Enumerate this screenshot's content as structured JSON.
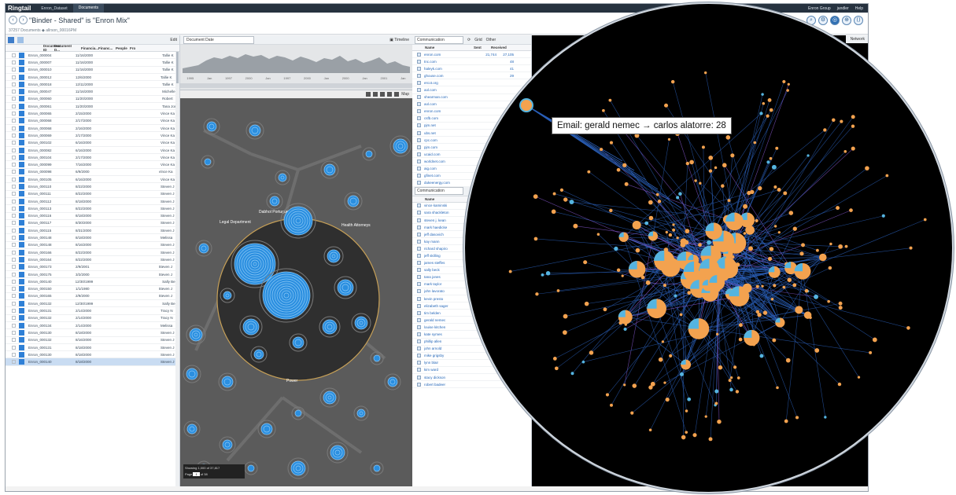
{
  "topbar": {
    "logo": "Ringtail",
    "case": "Enron_Dataset",
    "menu": "Documents",
    "right_items": [
      "Enron Group",
      "jandler",
      "Help"
    ]
  },
  "binder": {
    "title": "\"Binder - Shared\" is \"Enron Mix\"",
    "subtitle": "37257 Documents  ◆ allrson_00016PM"
  },
  "list": {
    "edit_label": "Edit",
    "headers": [
      "Document ID",
      "Document D...",
      "Financia...",
      "Financ...",
      "People",
      "Fro"
    ],
    "rows": [
      {
        "id": "Enron_000004",
        "date": "11/16/2000",
        "who": "Tallie K"
      },
      {
        "id": "Enron_000007",
        "date": "11/16/2000",
        "who": "Tallie K"
      },
      {
        "id": "Enron_000010",
        "date": "11/16/2000",
        "who": "Tallie K"
      },
      {
        "id": "Enron_000012",
        "date": "12/6/2000",
        "who": "Tallie K"
      },
      {
        "id": "Enron_000018",
        "date": "12/11/2000",
        "who": "Tallie K"
      },
      {
        "id": "Enron_000047",
        "date": "11/16/2000",
        "who": "Michelle"
      },
      {
        "id": "Enron_000060",
        "date": "11/20/2000",
        "who": "Robert"
      },
      {
        "id": "Enron_000061",
        "date": "11/20/2000",
        "who": "Tana Jon"
      },
      {
        "id": "Enron_000065",
        "date": "2/15/2000",
        "who": "Vince Ka"
      },
      {
        "id": "Enron_000068",
        "date": "2/17/2000",
        "who": "Vince Ka"
      },
      {
        "id": "Enron_000068",
        "date": "2/16/2000",
        "who": "Vince Ka"
      },
      {
        "id": "Enron_000069",
        "date": "2/17/2000",
        "who": "Vince Ka"
      },
      {
        "id": "Enron_000102",
        "date": "6/16/2000",
        "who": "Vince Ka"
      },
      {
        "id": "Enron_000082",
        "date": "6/16/2000",
        "who": "Vince Ka"
      },
      {
        "id": "Enron_000104",
        "date": "2/17/2000",
        "who": "Vince Ka"
      },
      {
        "id": "Enron_000099",
        "date": "7/16/2000",
        "who": "Vince Ka"
      },
      {
        "id": "Enron_000098",
        "date": "6/9/2000",
        "who": "Vince Ka"
      },
      {
        "id": "Enron_000105",
        "date": "6/16/2000",
        "who": "Vince Ka"
      },
      {
        "id": "Enron_000110",
        "date": "8/22/2000",
        "who": "Steven J"
      },
      {
        "id": "Enron_000111",
        "date": "8/22/2000",
        "who": "Steven J"
      },
      {
        "id": "Enron_000112",
        "date": "8/18/2000",
        "who": "Steven J"
      },
      {
        "id": "Enron_000113",
        "date": "8/22/2000",
        "who": "Steven J"
      },
      {
        "id": "Enron_000116",
        "date": "8/18/2000",
        "who": "Steven J"
      },
      {
        "id": "Enron_000117",
        "date": "8/30/2000",
        "who": "Steven J"
      },
      {
        "id": "Enron_000115",
        "date": "8/31/2000",
        "who": "Steven J"
      },
      {
        "id": "Enron_000148",
        "date": "8/18/2000",
        "who": "Melissa"
      },
      {
        "id": "Enron_000148",
        "date": "8/16/2000",
        "who": "Steven J"
      },
      {
        "id": "Enron_000166",
        "date": "8/22/2000",
        "who": "Steven J"
      },
      {
        "id": "Enron_000164",
        "date": "8/22/2000",
        "who": "Steven J"
      },
      {
        "id": "Enron_000173",
        "date": "2/9/2001",
        "who": "Steven J"
      },
      {
        "id": "Enron_000175",
        "date": "3/2/2000",
        "who": "Steven J"
      },
      {
        "id": "Enron_000140",
        "date": "12/30/1999",
        "who": "Sally Be"
      },
      {
        "id": "Enron_000150",
        "date": "1/1/1980",
        "who": "Steven J"
      },
      {
        "id": "Enron_000165",
        "date": "2/9/2000",
        "who": "Steven J"
      },
      {
        "id": "Enron_000132",
        "date": "12/30/1999",
        "who": "Sally Be"
      },
      {
        "id": "Enron_000131",
        "date": "2/14/2000",
        "who": "Tracy N"
      },
      {
        "id": "Enron_000132",
        "date": "2/14/2000",
        "who": "Tracy N"
      },
      {
        "id": "Enron_000134",
        "date": "2/14/2000",
        "who": "Melissa"
      },
      {
        "id": "Enron_000130",
        "date": "8/18/2000",
        "who": "Steven J"
      },
      {
        "id": "Enron_000132",
        "date": "8/16/2000",
        "who": "Steven J"
      },
      {
        "id": "Enron_000131",
        "date": "8/18/2000",
        "who": "Steven J"
      },
      {
        "id": "Enron_000130",
        "date": "8/18/2000",
        "who": "Steven J"
      },
      {
        "id": "Enron_000140",
        "date": "8/18/2000",
        "who": "Steven J"
      }
    ]
  },
  "timeline": {
    "field": "Document Date",
    "label": "Timeline",
    "axis": [
      "1995",
      "Jan",
      "1997",
      "2000",
      "Jan",
      "1997",
      "2000",
      "Jan",
      "2000",
      "Jan",
      "2001",
      "Jan"
    ]
  },
  "cluster_labels": [
    "Legal Department",
    "Dabhol Portuguese",
    "Health Attorneys",
    "Power"
  ],
  "map_label": "Map",
  "paging": {
    "showing": "Showing 1,000 of 37,817",
    "page_label": "Page",
    "page_value": "1",
    "of_label": "of 38"
  },
  "communication": {
    "field": "Communication",
    "grid_label": "Grid",
    "other_label": "Other",
    "headers": [
      "Name",
      "Sent",
      "Received"
    ],
    "domains": [
      {
        "name": "enron.com",
        "sent": "21,744",
        "recv": "27,105"
      },
      {
        "name": "tnc.com",
        "sent": "",
        "recv": "48"
      },
      {
        "name": "haleyk.com",
        "sent": "",
        "recv": "41"
      },
      {
        "name": "ghouse.com",
        "sent": "",
        "recv": "29"
      },
      {
        "name": "ercot.org",
        "sent": "",
        "recv": ""
      },
      {
        "name": "aol.com",
        "sent": "",
        "recv": ""
      },
      {
        "name": "shearman.com",
        "sent": "",
        "recv": ""
      },
      {
        "name": "aol.com",
        "sent": "",
        "recv": ""
      },
      {
        "name": "enron.com",
        "sent": "",
        "recv": ""
      },
      {
        "name": "csfb.com",
        "sent": "",
        "recv": ""
      },
      {
        "name": "pjm.net",
        "sent": "",
        "recv": ""
      },
      {
        "name": "ubs.net",
        "sent": "",
        "recv": ""
      },
      {
        "name": "cpc.com",
        "sent": "",
        "recv": ""
      },
      {
        "name": "pjm.com",
        "sent": "",
        "recv": ""
      },
      {
        "name": "ucaid.com",
        "sent": "",
        "recv": ""
      },
      {
        "name": "worldnet.com",
        "sent": "",
        "recv": ""
      },
      {
        "name": "aig.com",
        "sent": "",
        "recv": ""
      },
      {
        "name": "gfinet.com",
        "sent": "",
        "recv": ""
      },
      {
        "name": "dukeenergy.com",
        "sent": "",
        "recv": ""
      }
    ],
    "people_field": "Communication",
    "people_header": "Name",
    "people": [
      {
        "name": "vince kaminski",
        "sent": "",
        "recv": ""
      },
      {
        "name": "sara shackleton",
        "sent": "",
        "recv": ""
      },
      {
        "name": "steven j. kean",
        "sent": "",
        "recv": ""
      },
      {
        "name": "mark haedicke",
        "sent": "",
        "recv": ""
      },
      {
        "name": "jeff dasovich",
        "sent": "",
        "recv": ""
      },
      {
        "name": "kay mann",
        "sent": "",
        "recv": ""
      },
      {
        "name": "richard shapiro",
        "sent": "",
        "recv": ""
      },
      {
        "name": "jeff skilling",
        "sent": "",
        "recv": ""
      },
      {
        "name": "james steffes",
        "sent": "",
        "recv": ""
      },
      {
        "name": "sally beck",
        "sent": "",
        "recv": ""
      },
      {
        "name": "tana jones",
        "sent": "",
        "recv": ""
      },
      {
        "name": "mark taylor",
        "sent": "",
        "recv": ""
      },
      {
        "name": "john lavorato",
        "sent": "",
        "recv": ""
      },
      {
        "name": "kevin presto",
        "sent": "",
        "recv": ""
      },
      {
        "name": "elizabeth sager",
        "sent": "",
        "recv": ""
      },
      {
        "name": "tim belden",
        "sent": "",
        "recv": ""
      },
      {
        "name": "gerald nemec",
        "sent": "",
        "recv": ""
      },
      {
        "name": "louise kitchen",
        "sent": "",
        "recv": ""
      },
      {
        "name": "kate symes",
        "sent": "",
        "recv": ""
      },
      {
        "name": "phillip allen",
        "sent": "",
        "recv": ""
      },
      {
        "name": "john arnold",
        "sent": "",
        "recv": ""
      },
      {
        "name": "mike grigsby",
        "sent": "",
        "recv": ""
      },
      {
        "name": "lynn blair",
        "sent": "",
        "recv": ""
      },
      {
        "name": "kim ward",
        "sent": "",
        "recv": ""
      },
      {
        "name": "stacy dickson",
        "sent": "",
        "recv": ""
      },
      {
        "name": "robert badeer",
        "sent": "",
        "recv": ""
      }
    ]
  },
  "network": {
    "view_label": "Network",
    "tooltip": "Email: gerald nemec → carlos alatorre: 28",
    "colors": {
      "node": "#f3a24f",
      "node_alt": "#55b4e0",
      "edge": "#2a5fb8",
      "edge_alt": "#8b5bd6",
      "background": "#000000"
    }
  },
  "icons": [
    "back-icon",
    "forward-icon",
    "grid-view-icon",
    "list-view-icon",
    "calendar-icon",
    "refresh-icon",
    "help-icon"
  ]
}
